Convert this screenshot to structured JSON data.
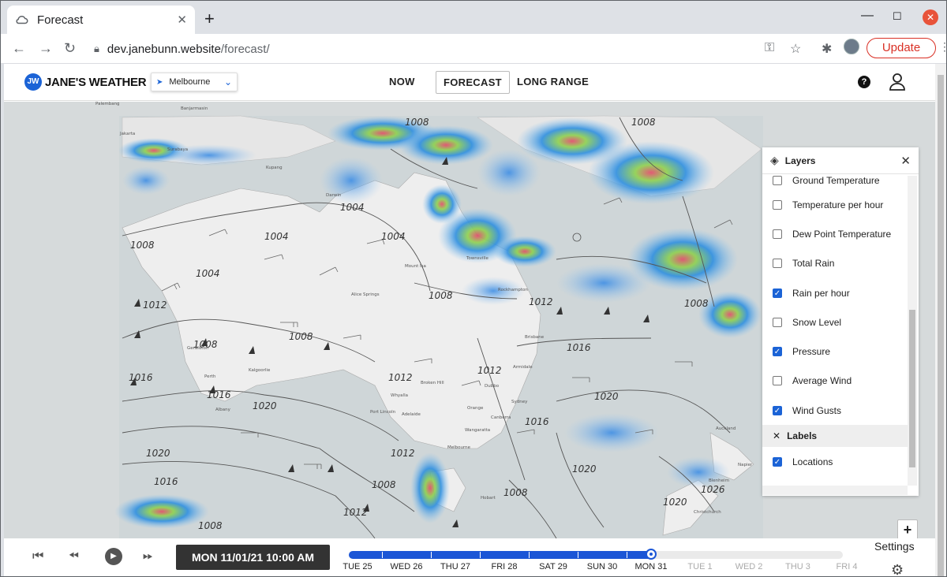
{
  "browser": {
    "tab_title": "Forecast",
    "url_host": "dev.janebunn.website",
    "url_path": "/forecast/",
    "update_label": "Update"
  },
  "header": {
    "logo_badge": "JW",
    "brand": "JANE'S WEATHER",
    "location": "Melbourne",
    "nav": {
      "now": "NOW",
      "forecast": "FORECAST",
      "long_range": "LONG RANGE"
    },
    "help_glyph": "?"
  },
  "map": {
    "pressure_labels": [
      "1008",
      "1008",
      "1004",
      "1004",
      "1004",
      "1008",
      "1004",
      "1008",
      "1012",
      "1012",
      "1008",
      "1016",
      "1008",
      "1012",
      "1012",
      "1016",
      "1020",
      "1016",
      "1020",
      "1008",
      "1020",
      "1016",
      "1012",
      "1020",
      "1016",
      "1008",
      "1012",
      "1008",
      "1020",
      "1026",
      "1008"
    ],
    "places": [
      "Palembang",
      "Banjarmasin",
      "Jakarta",
      "Surabaya",
      "Kupang",
      "Darwin",
      "Alice Springs",
      "Mount Isa",
      "Townsville",
      "Rockhampton",
      "Brisbane",
      "Perth",
      "Kalgoorlie",
      "Whyalla",
      "Port Lincoln",
      "Adelaide",
      "Broken Hill",
      "Dubbo",
      "Orange",
      "Canberra",
      "Sydney",
      "Armidale",
      "Wangaratta",
      "Melbourne",
      "Hobart",
      "Auckland",
      "Napier",
      "Blenheim",
      "Christchurch",
      "Geraldton",
      "Albany"
    ]
  },
  "layers": {
    "title": "Layers",
    "items": [
      {
        "label": "Ground Temperature",
        "checked": false
      },
      {
        "label": "Temperature per hour",
        "checked": false
      },
      {
        "label": "Dew Point Temperature",
        "checked": false
      },
      {
        "label": "Total Rain",
        "checked": false
      },
      {
        "label": "Rain per hour",
        "checked": true
      },
      {
        "label": "Snow Level",
        "checked": false
      },
      {
        "label": "Pressure",
        "checked": true
      },
      {
        "label": "Average Wind",
        "checked": false
      },
      {
        "label": "Wind Gusts",
        "checked": true
      }
    ],
    "labels_section": "Labels",
    "label_items": [
      {
        "label": "Locations",
        "checked": true
      }
    ]
  },
  "player": {
    "current": "MON 11/01/21 10:00 AM",
    "days": [
      "TUE 25",
      "WED 26",
      "THU 27",
      "FRI 28",
      "SAT 29",
      "SUN 30",
      "MON 31",
      "TUE 1",
      "WED 2",
      "THU 3",
      "FRI 4"
    ],
    "current_day_index": 6,
    "settings_label": "Settings"
  },
  "colors": {
    "accent": "#1b63d6",
    "update_red": "#d93025",
    "map_bg": "#d6dadb"
  }
}
